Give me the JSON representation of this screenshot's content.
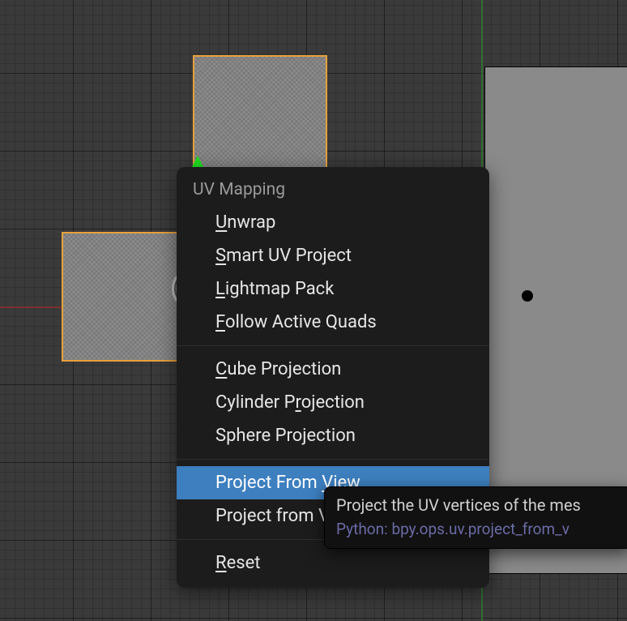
{
  "menu": {
    "title": "UV Mapping",
    "items": [
      {
        "label": "Unwrap",
        "hotchar": "U",
        "rest": "nwrap"
      },
      {
        "label": "Smart UV Project",
        "hotchar": "S",
        "rest": "mart UV Project"
      },
      {
        "label": "Lightmap Pack",
        "hotchar": "L",
        "rest": "ightmap Pack"
      },
      {
        "label": "Follow Active Quads",
        "hotchar": "F",
        "rest": "ollow Active Quads"
      },
      {
        "label": "Cube Projection",
        "hotchar": "C",
        "rest": "ube Projection"
      },
      {
        "label": "Cylinder Projection",
        "pre": "Cylinder P",
        "hotchar": "r",
        "rest": "ojection"
      },
      {
        "label": "Sphere Projection",
        "plain": "Sphere Projection"
      },
      {
        "label": "Project From View",
        "pre": "Project From ",
        "hotchar": "V",
        "rest": "iew",
        "highlight": true
      },
      {
        "label": "Project from View (Bounds)",
        "pre": "Project from ",
        "plain_rest": "View (Bounds)"
      },
      {
        "label": "Reset",
        "hotchar": "R",
        "rest": "eset"
      }
    ]
  },
  "tooltip": {
    "description": "Project the UV vertices of the mes",
    "python": "Python: bpy.ops.uv.project_from_v"
  }
}
